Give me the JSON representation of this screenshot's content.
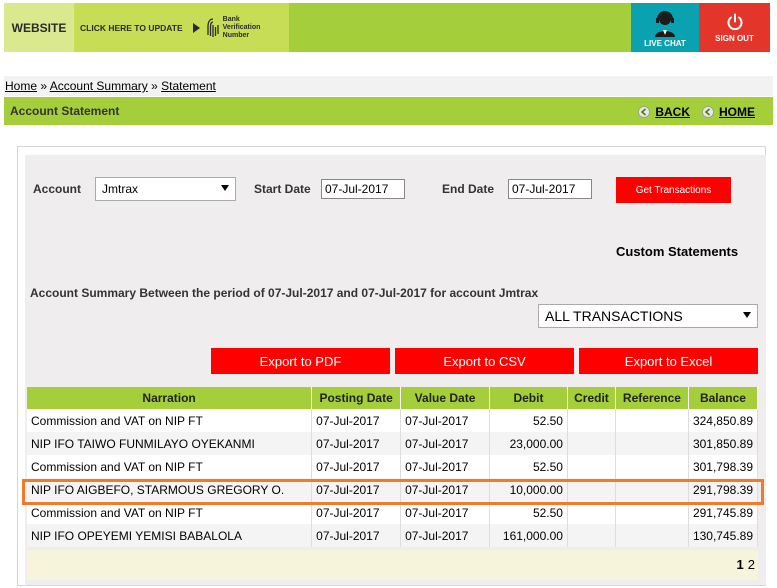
{
  "header": {
    "website_label": "WEBSITE",
    "update_label": "CLICK HERE TO UPDATE",
    "bvn_line1": "Bank",
    "bvn_line2": "Verification",
    "bvn_line3": "Number",
    "livechat_label": "LIVE CHAT",
    "signout_label": "SIGN OUT"
  },
  "breadcrumb": {
    "home": "Home",
    "sep": "»",
    "account_summary": "Account Summary",
    "statement": "Statement"
  },
  "titlebar": {
    "title": "Account Statement",
    "back": "BACK",
    "home": "HOME"
  },
  "form": {
    "account_label": "Account",
    "account_value": "Jmtrax",
    "start_label": "Start Date",
    "start_value": "07-Jul-2017",
    "end_label": "End Date",
    "end_value": "07-Jul-2017",
    "get_button": "Get Transactions",
    "custom_title": "Custom Statements",
    "summary": "Account Summary Between the period of 07-Jul-2017 and 07-Jul-2017 for account Jmtrax",
    "filter_value": "ALL TRANSACTIONS"
  },
  "exports": {
    "pdf": "Export to PDF",
    "csv": "Export to CSV",
    "excel": "Export to Excel"
  },
  "table": {
    "headers": [
      "Narration",
      "Posting Date",
      "Value Date",
      "Debit",
      "Credit",
      "Reference",
      "Balance"
    ],
    "rows": [
      [
        "Commission and VAT on NIP FT",
        "07-Jul-2017",
        "07-Jul-2017",
        "52.50",
        "",
        "",
        "324,850.89"
      ],
      [
        "NIP IFO TAIWO FUNMILAYO OYEKANMI",
        "07-Jul-2017",
        "07-Jul-2017",
        "23,000.00",
        "",
        "",
        "301,850.89"
      ],
      [
        "Commission and VAT on NIP FT",
        "07-Jul-2017",
        "07-Jul-2017",
        "52.50",
        "",
        "",
        "301,798.39"
      ],
      [
        "NIP IFO AIGBEFO, STARMOUS GREGORY O.",
        "07-Jul-2017",
        "07-Jul-2017",
        "10,000.00",
        "",
        "",
        "291,798.39"
      ],
      [
        "Commission and VAT on NIP FT",
        "07-Jul-2017",
        "07-Jul-2017",
        "52.50",
        "",
        "",
        "291,745.89"
      ],
      [
        "NIP IFO OPEYEMI YEMISI BABALOLA",
        "07-Jul-2017",
        "07-Jul-2017",
        "161,000.00",
        "",
        "",
        "130,745.89"
      ]
    ]
  },
  "pager": {
    "current": "1",
    "next": "2"
  },
  "colors": {
    "brand_green": "#a4cf3b",
    "alert_red": "#ff0000",
    "highlight_orange": "#f07c2a",
    "chat_teal": "#0aa2b0"
  }
}
